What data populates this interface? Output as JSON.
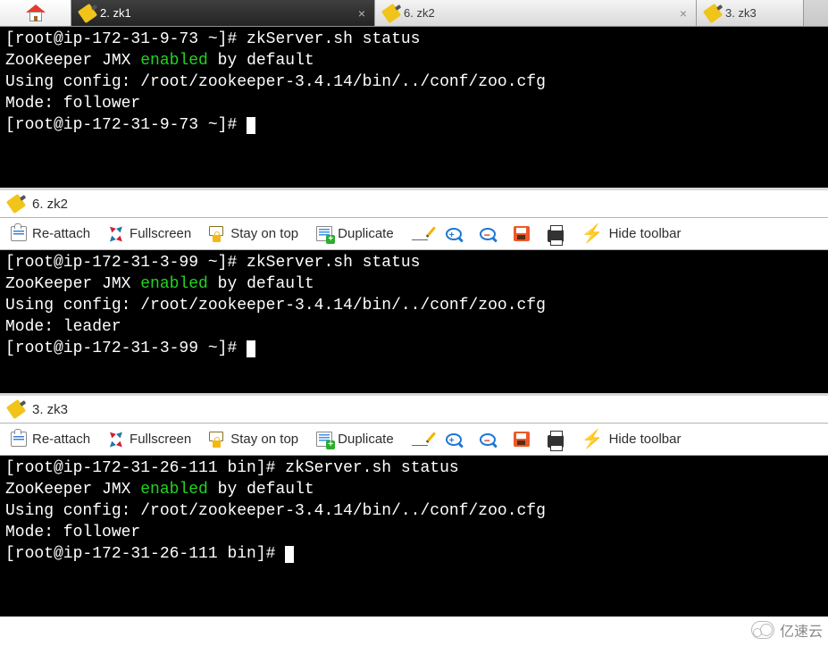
{
  "tabs": {
    "home": {
      "name": "home"
    },
    "zk1": {
      "label": "2. zk1",
      "close": "×"
    },
    "zk2": {
      "label": "6. zk2",
      "close": "×"
    },
    "zk3": {
      "label": "3. zk3"
    }
  },
  "panel2": {
    "title": "6. zk2"
  },
  "panel3": {
    "title": "3. zk3"
  },
  "toolbar": {
    "reattach": "Re-attach",
    "fullscreen": "Fullscreen",
    "stayontop": "Stay on top",
    "duplicate": "Duplicate",
    "hide": "Hide toolbar"
  },
  "term1": {
    "prompt1_a": "[root@ip-172-31-9-73 ~]# ",
    "cmd1": "zkServer.sh status",
    "l2a": "ZooKeeper JMX ",
    "l2b": "enabled",
    "l2c": " by default",
    "l3": "Using config: /root/zookeeper-3.4.14/bin/../conf/zoo.cfg",
    "l4": "Mode: follower",
    "prompt2": "[root@ip-172-31-9-73 ~]# "
  },
  "term2": {
    "prompt1_a": "[root@ip-172-31-3-99 ~]# ",
    "cmd1": "zkServer.sh status",
    "l2a": "ZooKeeper JMX ",
    "l2b": "enabled",
    "l2c": " by default",
    "l3": "Using config: /root/zookeeper-3.4.14/bin/../conf/zoo.cfg",
    "l4": "Mode: leader",
    "prompt2": "[root@ip-172-31-3-99 ~]# "
  },
  "term3": {
    "prompt1_a": "[root@ip-172-31-26-111 bin]# ",
    "cmd1": "zkServer.sh status",
    "l2a": "ZooKeeper JMX ",
    "l2b": "enabled",
    "l2c": " by default",
    "l3": "Using config: /root/zookeeper-3.4.14/bin/../conf/zoo.cfg",
    "l4": "Mode: follower",
    "prompt2": "[root@ip-172-31-26-111 bin]# "
  },
  "watermark": {
    "text": "亿速云"
  }
}
